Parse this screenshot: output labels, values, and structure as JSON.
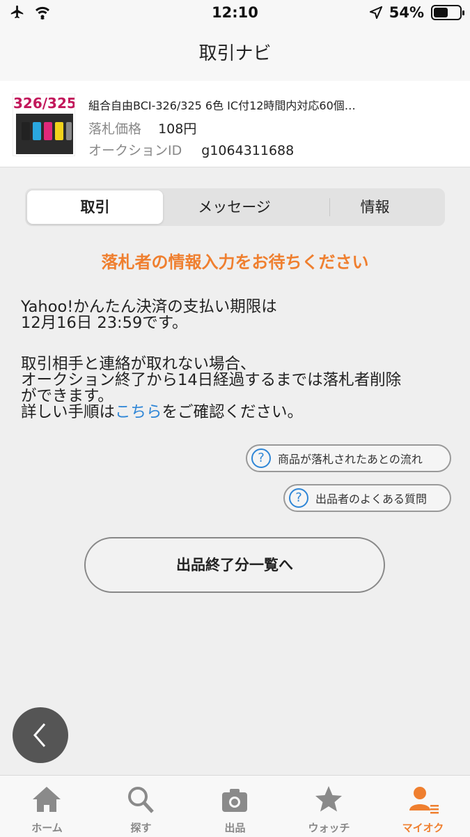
{
  "status": {
    "time": "12:10",
    "battery": "54%"
  },
  "header": {
    "title": "取引ナビ"
  },
  "item": {
    "thumb_text": "326/325",
    "title": "組合自由BCI-326/325 6色 IC付12時間内対応60個…",
    "price_label": "落札価格",
    "price_value": "108円",
    "id_label": "オークションID",
    "id_value": "g1064311688"
  },
  "tabs": [
    {
      "label": "取引"
    },
    {
      "label": "メッセージ"
    },
    {
      "label": "情報"
    }
  ],
  "notice": "落札者の情報入力をお待ちください",
  "body": {
    "p1_line1": "Yahoo!かんたん決済の支払い期限は",
    "p1_line2": "12月16日 23:59です。",
    "p2_line1": "取引相手と連絡が取れない場合、",
    "p2_line2": "オークション終了から14日経過するまでは落札者削除",
    "p2_line3": "ができます。",
    "p2_line4_prefix": "詳しい手順は",
    "p2_link": "こちら",
    "p2_line4_suffix": "をご確認ください。"
  },
  "help_links": [
    {
      "label": "商品が落札されたあとの流れ"
    },
    {
      "label": "出品者のよくある質問"
    }
  ],
  "main_button": "出品終了分一覧へ",
  "tabbar": [
    {
      "label": "ホーム",
      "icon": "home-icon"
    },
    {
      "label": "探す",
      "icon": "search-icon"
    },
    {
      "label": "出品",
      "icon": "camera-icon"
    },
    {
      "label": "ウォッチ",
      "icon": "star-icon"
    },
    {
      "label": "マイオク",
      "icon": "user-list-icon"
    }
  ],
  "colors": {
    "accent": "#ef7f2f",
    "link": "#2f86d6",
    "background": "#efefef"
  }
}
